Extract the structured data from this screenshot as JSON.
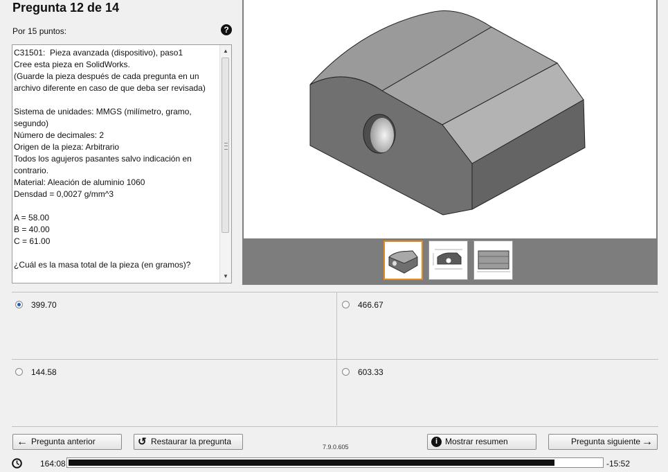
{
  "header": {
    "title": "Pregunta 12 de 14",
    "points": "Por 15 puntos:",
    "help_icon": "question-circle-icon"
  },
  "question": {
    "text": "C31501:  Pieza avanzada (dispositivo), paso1\nCree esta pieza en SolidWorks.\n(Guarde la pieza después de cada pregunta en un archivo diferente en caso de que deba ser revisada)\n\nSistema de unidades: MMGS (milímetro, gramo, segundo)\nNúmero de decimales: 2\nOrigen de la pieza: Arbitrario\nTodos los agujeros pasantes salvo indicación en contrario.\nMaterial: Aleación de aluminio 1060\nDensdad = 0,0027 g/mm^3\n\nA = 58.00\nB = 40.00\nC = 61.00\n\n¿Cuál es la masa total de la pieza (en gramos)?"
  },
  "viewer": {
    "thumbnails": [
      "isometric-view",
      "front-drawing-view",
      "side-drawing-view"
    ],
    "selected_thumbnail": 0,
    "accent": "#e8891c"
  },
  "answers": [
    {
      "label": "399.70",
      "selected": true
    },
    {
      "label": "466.67",
      "selected": false
    },
    {
      "label": "144.58",
      "selected": false
    },
    {
      "label": "603.33",
      "selected": false
    }
  ],
  "footer": {
    "prev_label": "Pregunta anterior",
    "reset_label": "Restaurar la pregunta",
    "version": "7.9.0.605",
    "summary_label": "Mostrar resumen",
    "next_label": "Pregunta siguiente"
  },
  "timer": {
    "elapsed": "164:08",
    "remaining": "-15:52",
    "progress": 0.912
  }
}
